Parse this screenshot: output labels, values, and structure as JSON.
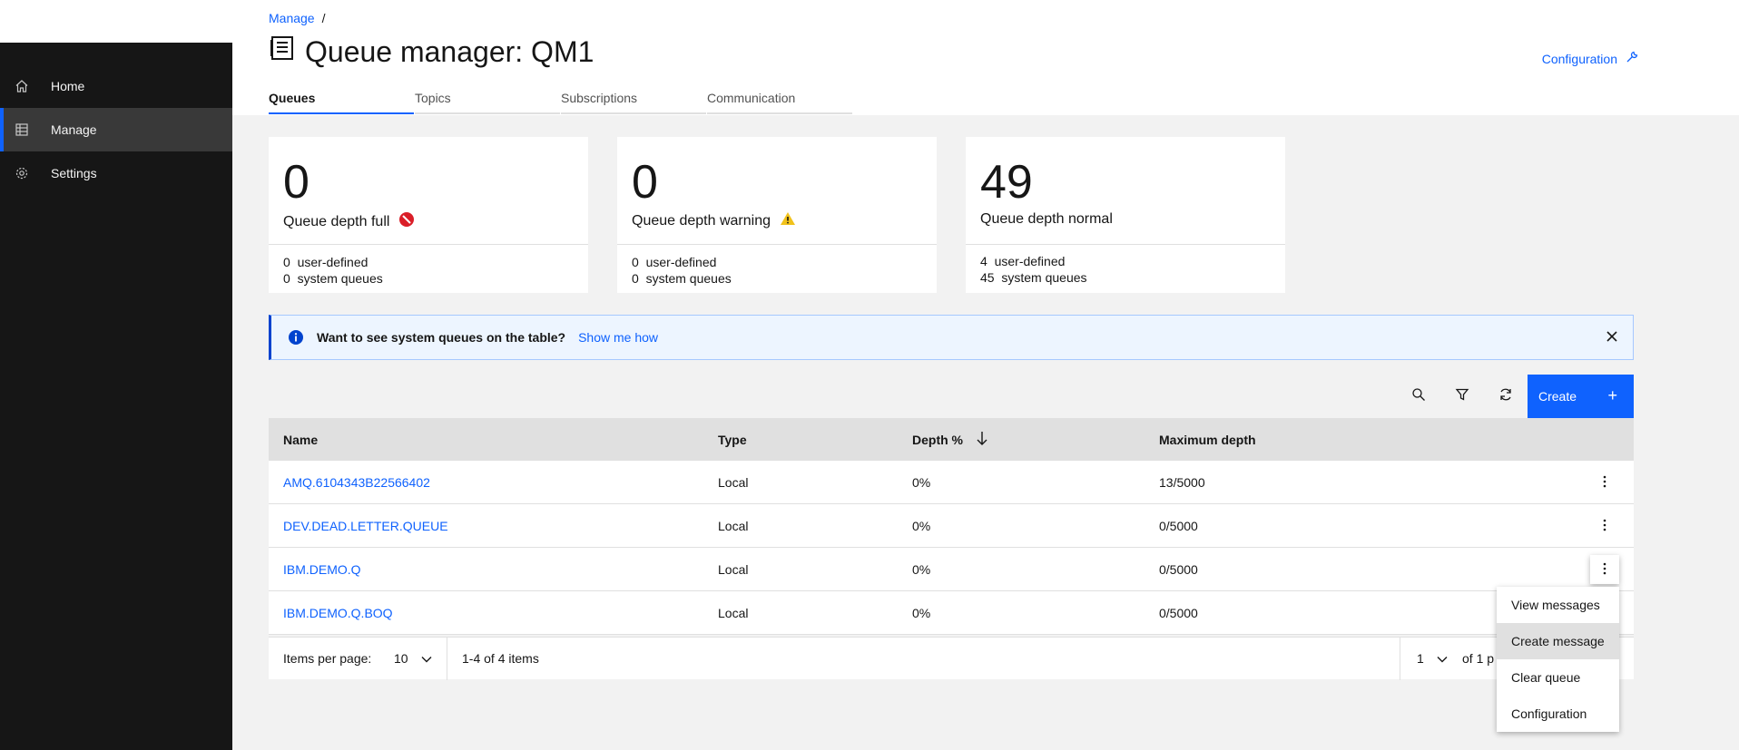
{
  "sidebar": {
    "items": [
      {
        "label": "Home",
        "icon": "home-icon"
      },
      {
        "label": "Manage",
        "icon": "table-icon"
      },
      {
        "label": "Settings",
        "icon": "gear-icon"
      }
    ]
  },
  "breadcrumb": {
    "link": "Manage",
    "separator": "/"
  },
  "page": {
    "title": "Queue manager: QM1"
  },
  "header": {
    "config_label": "Configuration"
  },
  "tabs": [
    {
      "label": "Queues"
    },
    {
      "label": "Topics"
    },
    {
      "label": "Subscriptions"
    },
    {
      "label": "Communication"
    }
  ],
  "tiles": [
    {
      "value": "0",
      "label": "Queue depth full",
      "user_count": "0",
      "user_label": "user-defined",
      "system_count": "0",
      "system_label": "system queues"
    },
    {
      "value": "0",
      "label": "Queue depth warning",
      "user_count": "0",
      "user_label": "user-defined",
      "system_count": "0",
      "system_label": "system queues"
    },
    {
      "value": "49",
      "label": "Queue depth normal",
      "user_count": "4",
      "user_label": "user-defined",
      "system_count": "45",
      "system_label": "system queues"
    }
  ],
  "notification": {
    "title": "Want to see system queues on the table?",
    "link": "Show me how"
  },
  "toolbar": {
    "create_label": "Create",
    "create_icon": "+"
  },
  "table": {
    "columns": [
      "Name",
      "Type",
      "Depth %",
      "Maximum depth"
    ],
    "rows": [
      {
        "name": "AMQ.6104343B22566402",
        "type": "Local",
        "depth": "0%",
        "max": "13/5000"
      },
      {
        "name": "DEV.DEAD.LETTER.QUEUE",
        "type": "Local",
        "depth": "0%",
        "max": "0/5000"
      },
      {
        "name": "IBM.DEMO.Q",
        "type": "Local",
        "depth": "0%",
        "max": "0/5000"
      },
      {
        "name": "IBM.DEMO.Q.BOQ",
        "type": "Local",
        "depth": "0%",
        "max": "0/5000"
      }
    ]
  },
  "pagination": {
    "items_per_page_label": "Items per page:",
    "items_per_page": "10",
    "range": "1-4 of 4 items",
    "page": "1",
    "of_pages": "of 1 p"
  },
  "menu": {
    "items": [
      "View messages",
      "Create message",
      "Clear queue",
      "Configuration"
    ]
  },
  "colors": {
    "accent": "#0f62fe",
    "sidebar": "#161616",
    "error": "#da1e28",
    "warning": "#f1c21b"
  }
}
